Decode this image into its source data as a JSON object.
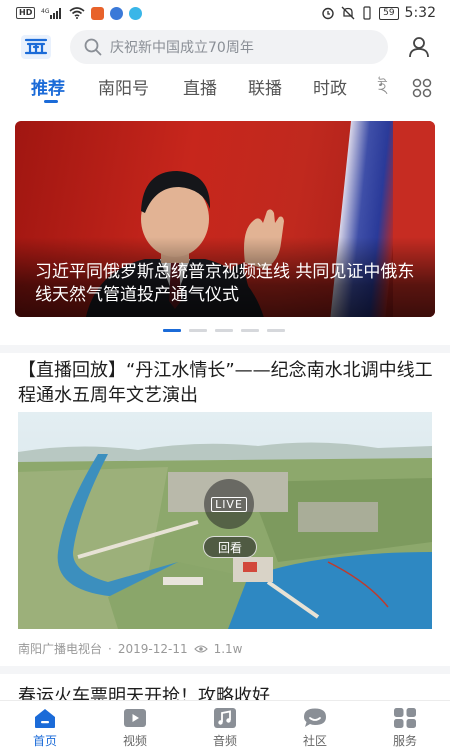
{
  "status_bar": {
    "signal_text": "HD",
    "network": "4G",
    "battery": "59",
    "time": "5:32"
  },
  "search": {
    "placeholder": "庆祝新中国成立70周年"
  },
  "tabs": [
    {
      "label": "推荐",
      "active": true
    },
    {
      "label": "南阳号"
    },
    {
      "label": "直播"
    },
    {
      "label": "联播"
    },
    {
      "label": "时政"
    },
    {
      "label": "ই"
    }
  ],
  "hero": {
    "caption": "习近平同俄罗斯总统普京视频连线 共同见证中俄东线天然气管道投产通气仪式",
    "carousel_total": 5,
    "carousel_index": 1
  },
  "article": {
    "title": "【直播回放】“丹江水情长”——纪念南水北调中线工程通水五周年文艺演出",
    "live_badge": "LIVE",
    "replay_label": "回看",
    "source": "南阳广播电视台",
    "date": "2019-12-11",
    "views": "1.1w"
  },
  "next_article": {
    "title": "春运火车票明天开抢！攻略收好"
  },
  "bottom_nav": [
    {
      "label": "首页",
      "icon": "home-icon",
      "active": true
    },
    {
      "label": "视频",
      "icon": "video-icon"
    },
    {
      "label": "音频",
      "icon": "audio-icon"
    },
    {
      "label": "社区",
      "icon": "community-icon"
    },
    {
      "label": "服务",
      "icon": "services-icon"
    }
  ],
  "colors": {
    "accent": "#1b6bd8",
    "muted": "#999999"
  }
}
